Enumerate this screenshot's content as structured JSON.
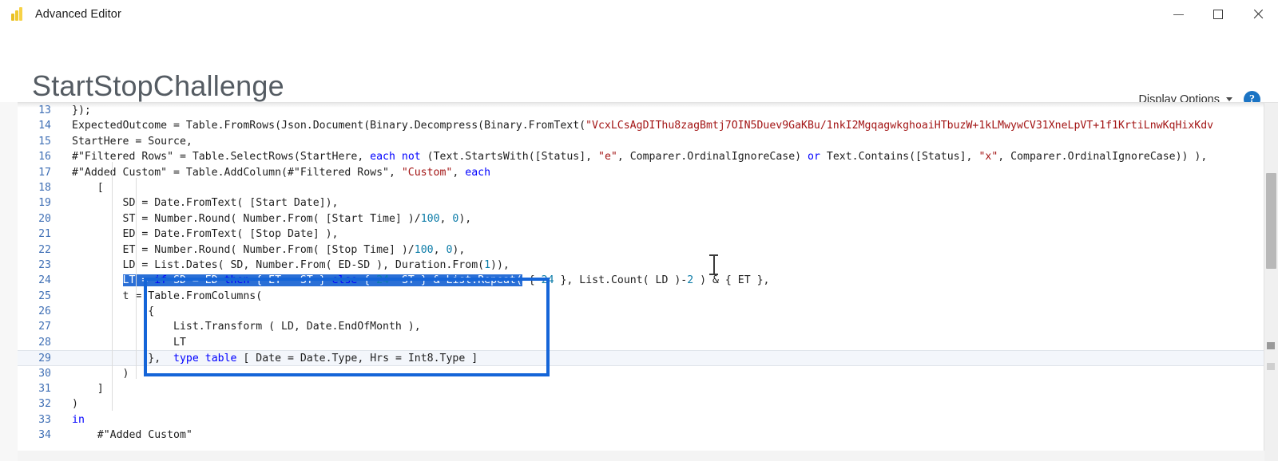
{
  "window": {
    "title": "Advanced Editor",
    "app_icon": "power-bi-icon",
    "minimize_label": "Minimize",
    "maximize_label": "Maximize",
    "close_label": "Close"
  },
  "header": {
    "query_name": "StartStopChallenge",
    "display_options_label": "Display Options",
    "help_label": "?"
  },
  "editor": {
    "language": "Power Query M",
    "first_visible_line": 13,
    "last_visible_line": 34,
    "current_line": 29,
    "lines": [
      {
        "n": "13",
        "text": "});"
      },
      {
        "n": "14",
        "text": "ExpectedOutcome = Table.FromRows(Json.Document(Binary.Decompress(Binary.FromText(\"VcxLCsAgDIThu8zagBmtj7OIN5Duev9GaKBu/1nkI2MgqagwkghoaiHTbuzW+1kLMwywCV31XneLpVT+1f1KrtiLnwKqHixKdv"
      },
      {
        "n": "15",
        "text": "StartHere = Source,"
      },
      {
        "n": "16",
        "text": "#\"Filtered Rows\" = Table.SelectRows(StartHere, each not (Text.StartsWith([Status], \"e\", Comparer.OrdinalIgnoreCase) or Text.Contains([Status], \"x\", Comparer.OrdinalIgnoreCase)) ),"
      },
      {
        "n": "17",
        "text": "#\"Added Custom\" = Table.AddColumn(#\"Filtered Rows\", \"Custom\", each"
      },
      {
        "n": "18",
        "text": "    ["
      },
      {
        "n": "19",
        "text": "        SD = Date.FromText( [Start Date]),"
      },
      {
        "n": "20",
        "text": "        ST = Number.Round( Number.From( [Start Time] )/100, 0),"
      },
      {
        "n": "21",
        "text": "        ED = Date.FromText( [Stop Date] ),"
      },
      {
        "n": "22",
        "text": "        ET = Number.Round( Number.From( [Stop Time] )/100, 0),"
      },
      {
        "n": "23",
        "text": "        LD = List.Dates( SD, Number.From( ED-SD ), Duration.From(1)),"
      },
      {
        "n": "24",
        "text": "        LT = if SD = ED then { ET - ST } else { 24- ST } & List.Repeat( { 24 }, List.Count( LD )-2 ) & { ET },"
      },
      {
        "n": "25",
        "text": "        t = Table.FromColumns("
      },
      {
        "n": "26",
        "text": "            {"
      },
      {
        "n": "27",
        "text": "                List.Transform ( LD, Date.EndOfMonth ),"
      },
      {
        "n": "28",
        "text": "                LT"
      },
      {
        "n": "29",
        "text": "            },  type table [ Date = Date.Type, Hrs = Int8.Type ]"
      },
      {
        "n": "30",
        "text": "        )"
      },
      {
        "n": "31",
        "text": "    ]"
      },
      {
        "n": "32",
        "text": ")"
      },
      {
        "n": "33",
        "text": "in"
      },
      {
        "n": "34",
        "text": "    #\"Added Custom\""
      }
    ],
    "annotation": {
      "type": "highlight-rectangle",
      "color": "#1565d8",
      "covers_lines": "25-30"
    },
    "selection": {
      "line": 24,
      "text": "LT = if SD = ED then { ET - ST } else { 24- ST } & List.Repeat(",
      "color": "#2a6fd6"
    }
  },
  "colors": {
    "keyword": "#0000ff",
    "string": "#a31515",
    "number": "#0c7ca8",
    "line_number": "#3f6fb5",
    "accent_box": "#1565d8",
    "help_blue": "#1b74c4",
    "brand_yellow": "#f2c811"
  }
}
